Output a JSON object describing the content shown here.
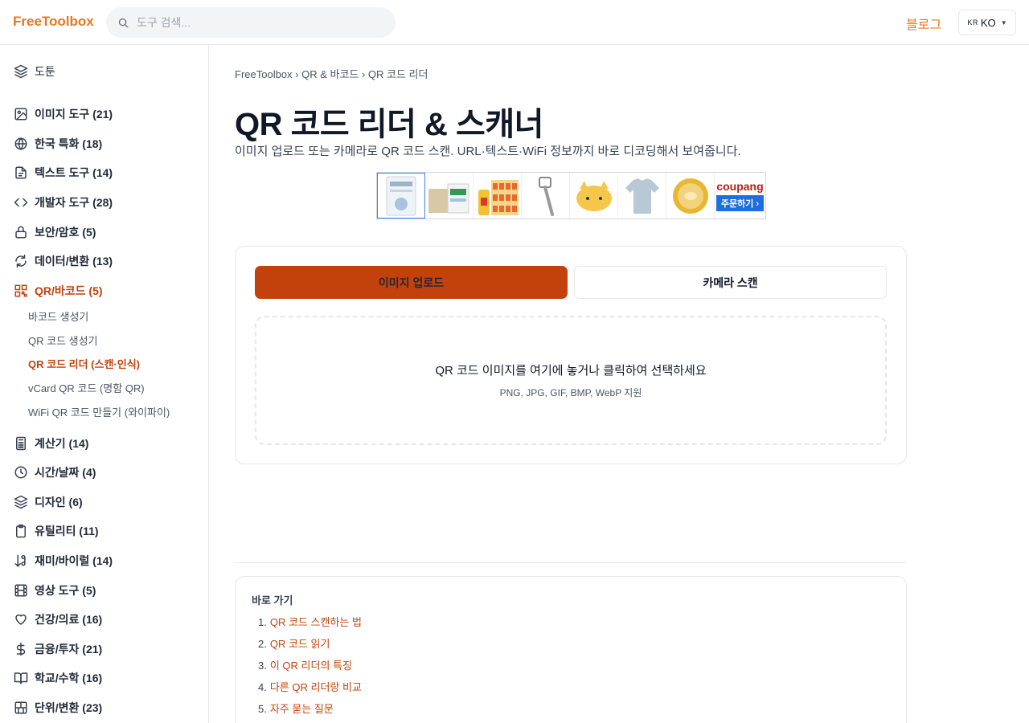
{
  "header": {
    "logo": "FreeToolbox",
    "search_placeholder": "도구 검색...",
    "blog_label": "블로그",
    "lang_flag": "KR",
    "lang_label": "KO"
  },
  "sidebar": {
    "top_label": "도툰",
    "categories": [
      {
        "label": "이미지 도구 (21)"
      },
      {
        "label": "한국 특화 (18)"
      },
      {
        "label": "텍스트 도구 (14)"
      },
      {
        "label": "개발자 도구 (28)"
      },
      {
        "label": "보안/암호 (5)"
      },
      {
        "label": "데이터/변환 (13)"
      },
      {
        "label": "QR/바코드 (5)"
      },
      {
        "label": "계산기 (14)"
      },
      {
        "label": "시간/날짜 (4)"
      },
      {
        "label": "디자인 (6)"
      },
      {
        "label": "유틸리티 (11)"
      },
      {
        "label": "재미/바이럴 (14)"
      },
      {
        "label": "영상 도구 (5)"
      },
      {
        "label": "건강/의료 (16)"
      },
      {
        "label": "금융/투자 (21)"
      },
      {
        "label": "학교/수학 (16)"
      },
      {
        "label": "단위/변환 (23)"
      }
    ],
    "sub_items": [
      {
        "label": "바코드 생성기"
      },
      {
        "label": "QR 코드 생성기"
      },
      {
        "label": "QR 코드 리더 (스캔·인식)"
      },
      {
        "label": "vCard QR 코드 (명함 QR)"
      },
      {
        "label": "WiFi QR 코드 만들기 (와이파이)"
      }
    ]
  },
  "main": {
    "breadcrumb": "FreeToolbox › QR & 바코드 › QR 코드 리더",
    "title": "QR 코드 리더 & 스캐너",
    "description": "이미지 업로드 또는 카메라로 QR 코드 스캔. URL·텍스트·WiFi 정보까지 바로 디코딩해서 보여줍니다.",
    "ad": {
      "brand": "coupang",
      "cta": "주문하기 ›"
    },
    "tabs": [
      {
        "label": "이미지 업로드"
      },
      {
        "label": "카메라 스캔"
      }
    ],
    "dropzone": {
      "main_text": "QR 코드 이미지를 여기에 놓거나 클릭하여 선택하세요",
      "sub_text": "PNG, JPG, GIF, BMP, WebP 지원"
    },
    "toc": {
      "title": "바로 가기",
      "items": [
        {
          "num": "1.",
          "label": "QR 코드 스캔하는 법"
        },
        {
          "num": "2.",
          "label": "QR 코드 읽기"
        },
        {
          "num": "3.",
          "label": "이 QR 리더의 특징"
        },
        {
          "num": "4.",
          "label": "다른 QR 리더랑 비교"
        },
        {
          "num": "5.",
          "label": "자주 묻는 질문"
        }
      ]
    }
  },
  "colors": {
    "accent": "#e8761e",
    "active": "#c2410c",
    "tab_active_bg": "#c2410c",
    "border": "#e5e7eb"
  }
}
